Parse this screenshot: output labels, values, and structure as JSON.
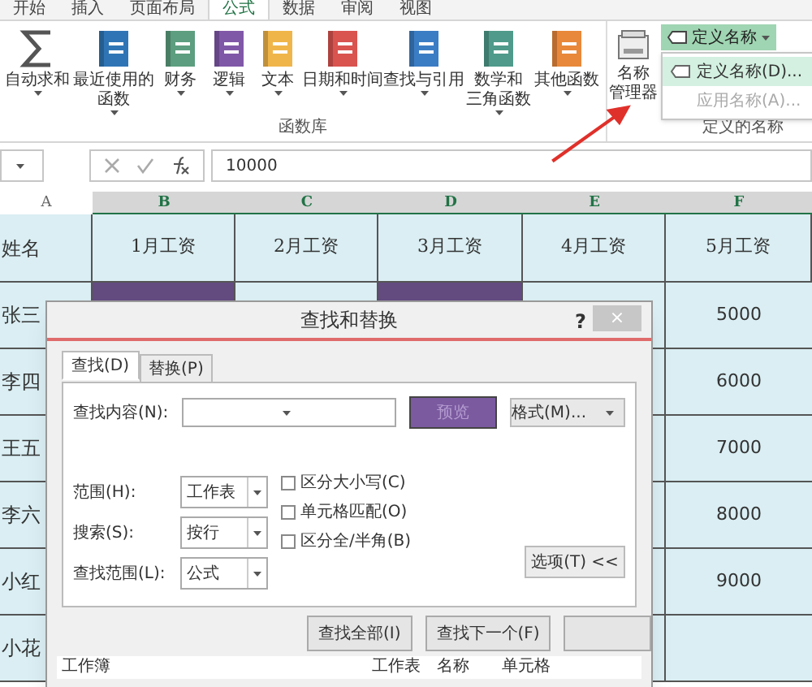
{
  "ribbon_tabs": [
    {
      "label": "开始",
      "selected": false
    },
    {
      "label": "插入",
      "selected": false
    },
    {
      "label": "页面布局",
      "selected": false
    },
    {
      "label": "公式",
      "selected": true
    },
    {
      "label": "数据",
      "selected": false
    },
    {
      "label": "审阅",
      "selected": false
    },
    {
      "label": "视图",
      "selected": false
    }
  ],
  "function_library": {
    "label": "函数库",
    "buttons": [
      {
        "kind": "sum",
        "lines": [
          "自动求和"
        ]
      },
      {
        "kind": "recent",
        "lines": [
          "最近使用的",
          "函数"
        ]
      },
      {
        "kind": "finance",
        "lines": [
          "财务"
        ]
      },
      {
        "kind": "logic",
        "lines": [
          "逻辑"
        ]
      },
      {
        "kind": "text",
        "lines": [
          "文本"
        ]
      },
      {
        "kind": "date",
        "lines": [
          "日期和时间"
        ]
      },
      {
        "kind": "lookup",
        "lines": [
          "查找与引用"
        ]
      },
      {
        "kind": "math",
        "lines": [
          "数学和",
          "三角函数"
        ]
      },
      {
        "kind": "other",
        "lines": [
          "其他函数"
        ]
      }
    ]
  },
  "defined_names": {
    "label": "定义的名称",
    "name_manager": [
      "名称",
      "管理器"
    ],
    "define_button": "定义名称",
    "menu": [
      {
        "label": "定义名称(D)...",
        "selected": true,
        "disabled": false
      },
      {
        "label": "应用名称(A)...",
        "selected": false,
        "disabled": true
      }
    ]
  },
  "formula_bar": {
    "value": "10000"
  },
  "columns": [
    {
      "label": "A",
      "selected": false
    },
    {
      "label": "B",
      "selected": true
    },
    {
      "label": "C",
      "selected": true
    },
    {
      "label": "D",
      "selected": true
    },
    {
      "label": "E",
      "selected": true
    },
    {
      "label": "F",
      "selected": true
    }
  ],
  "header_row": [
    "姓名",
    "1月工资",
    "2月工资",
    "3月工资",
    "4月工资",
    "5月工资"
  ],
  "rows": [
    {
      "name": "张三",
      "highlighted": [
        true,
        false,
        true,
        false
      ],
      "may": "5000"
    },
    {
      "name": "李四",
      "may": "6000"
    },
    {
      "name": "王五",
      "may": "7000"
    },
    {
      "name": "李六",
      "may": "8000"
    },
    {
      "name": "小红",
      "may": "9000"
    },
    {
      "name": "小花"
    }
  ],
  "dialog": {
    "title": "查找和替换",
    "help": "?",
    "close": "×",
    "tabs": [
      {
        "label": "查找(D)",
        "selected": true
      },
      {
        "label": "替换(P)",
        "selected": false
      }
    ],
    "find_label": "查找内容(N):",
    "preview_button": "预览",
    "format_button": "格式(M)...",
    "options": [
      {
        "label": "范围(H):",
        "value": "工作表"
      },
      {
        "label": "搜索(S):",
        "value": "按行"
      },
      {
        "label": "查找范围(L):",
        "value": "公式"
      }
    ],
    "checkboxes": [
      {
        "label": "区分大小写(C)",
        "checked": false
      },
      {
        "label": "单元格匹配(O)",
        "checked": false
      },
      {
        "label": "区分全/半角(B)",
        "checked": false
      }
    ],
    "options_button": "选项(T) <<",
    "buttons": [
      "查找全部(I)",
      "查找下一个(F)"
    ],
    "result_columns": [
      "工作簿",
      "工作表",
      "名称",
      "单元格"
    ]
  }
}
